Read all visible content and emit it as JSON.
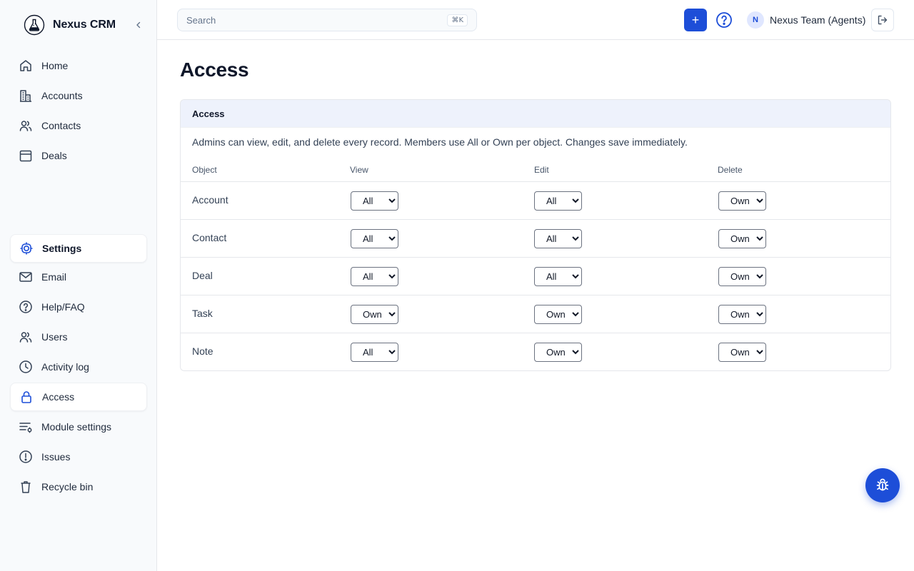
{
  "app": {
    "name": "Nexus CRM"
  },
  "sidebar": {
    "main": [
      {
        "label": "Home",
        "icon": "home-icon"
      },
      {
        "label": "Accounts",
        "icon": "building-icon"
      },
      {
        "label": "Contacts",
        "icon": "users-icon"
      },
      {
        "label": "Deals",
        "icon": "calendar-icon"
      }
    ],
    "settings": [
      {
        "label": "Settings",
        "icon": "settings-icon",
        "active": true
      },
      {
        "label": "Email",
        "icon": "mail-icon"
      },
      {
        "label": "Help/FAQ",
        "icon": "help-icon"
      },
      {
        "label": "Users",
        "icon": "users-icon"
      },
      {
        "label": "Activity log",
        "icon": "clock-icon"
      },
      {
        "label": "Access",
        "icon": "lock-icon",
        "active": true
      },
      {
        "label": "Module settings",
        "icon": "sliders-icon"
      },
      {
        "label": "Issues",
        "icon": "alert-icon"
      },
      {
        "label": "Recycle bin",
        "icon": "trash-icon"
      }
    ]
  },
  "topbar": {
    "search_placeholder": "Search",
    "search_shortcut": "⌘K",
    "add_label": "+",
    "user_initial": "N",
    "user_name": "Nexus Team (Agents)"
  },
  "page": {
    "title": "Access"
  },
  "access": {
    "header": "Access",
    "description": "Admins can view, edit, and delete every record. Members use All or Own per object. Changes save immediately.",
    "columns": [
      "Object",
      "View",
      "Edit",
      "Delete"
    ],
    "options": [
      "All",
      "Own"
    ],
    "rows": [
      {
        "object": "Account",
        "view": "All",
        "edit": "All",
        "delete": "Own"
      },
      {
        "object": "Contact",
        "view": "All",
        "edit": "All",
        "delete": "Own"
      },
      {
        "object": "Deal",
        "view": "All",
        "edit": "All",
        "delete": "Own"
      },
      {
        "object": "Task",
        "view": "Own",
        "edit": "Own",
        "delete": "Own"
      },
      {
        "object": "Note",
        "view": "All",
        "edit": "Own",
        "delete": "Own"
      }
    ]
  },
  "colors": {
    "accent": "#1d4ed8",
    "sidebar_bg": "#f8fafc",
    "card_header_bg": "#eef2fc"
  }
}
